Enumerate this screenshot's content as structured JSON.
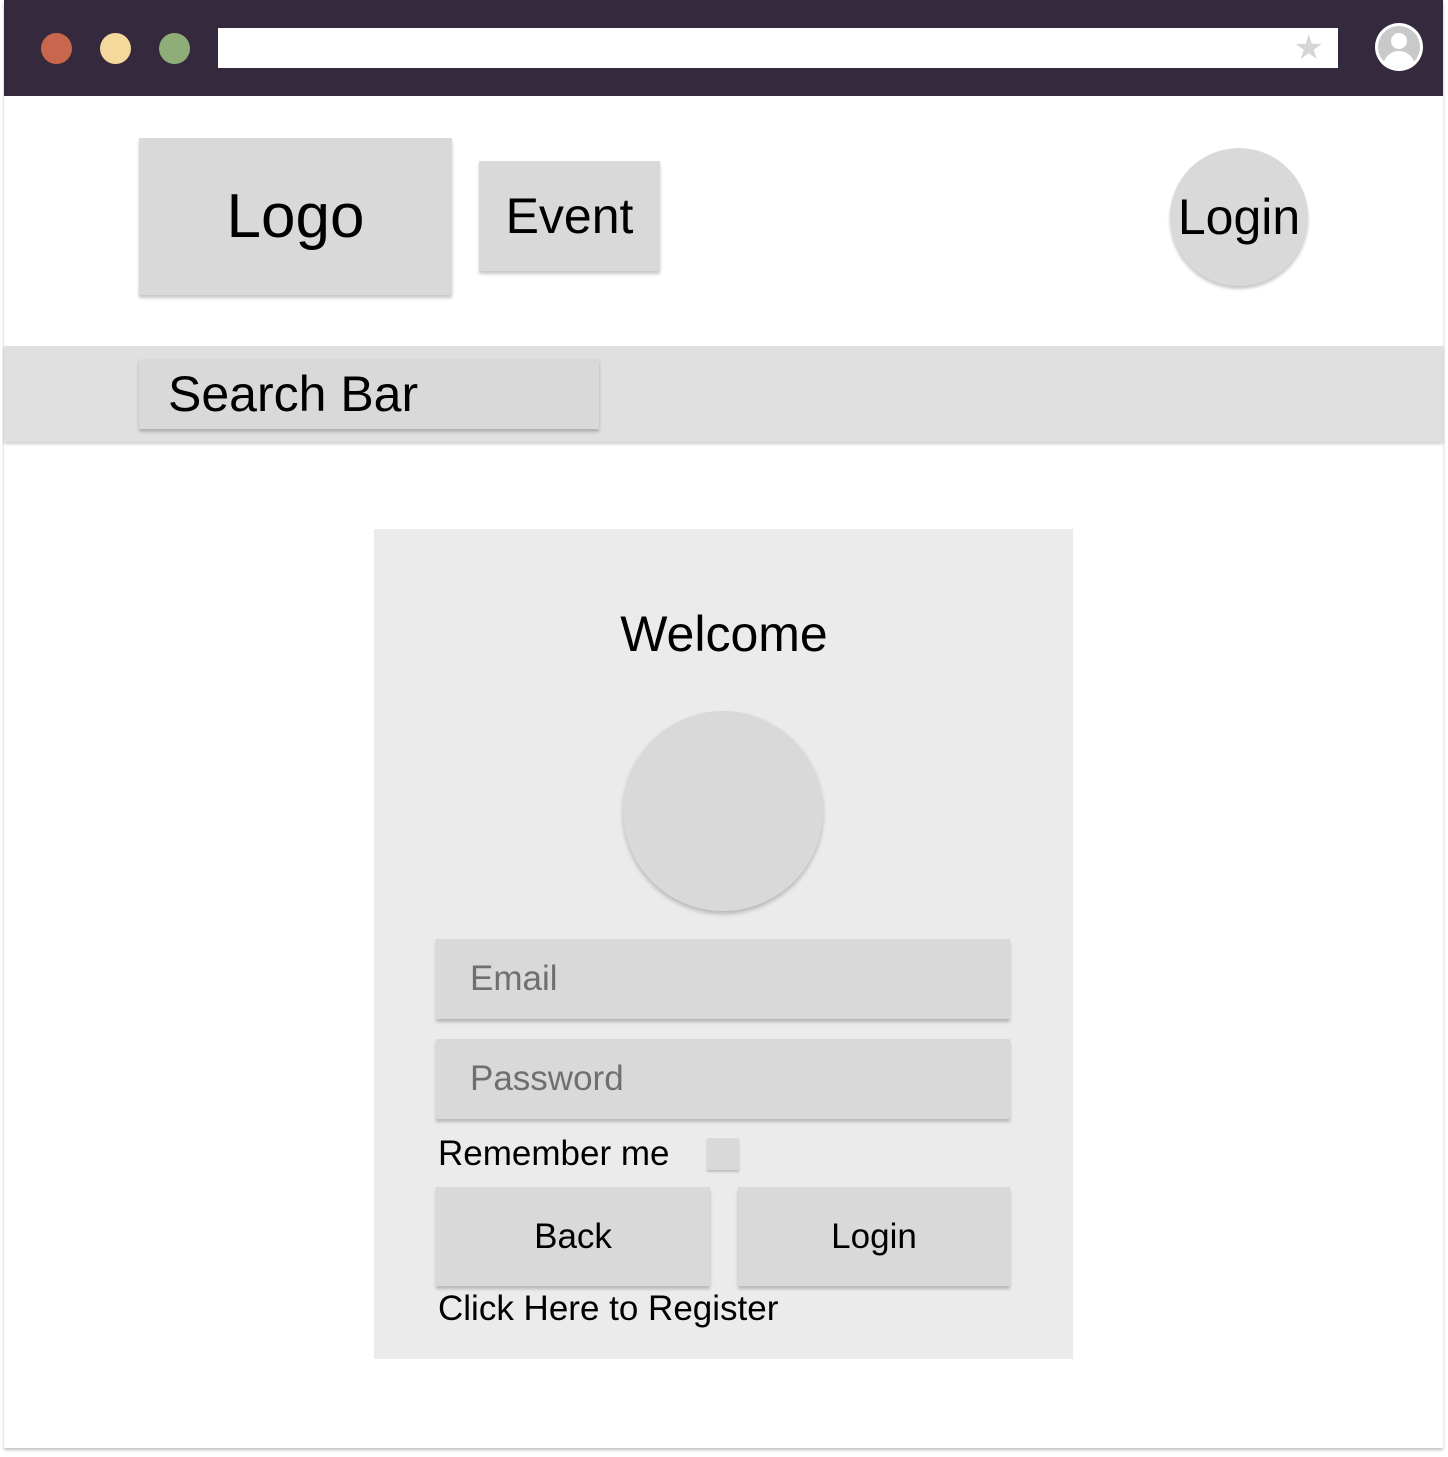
{
  "browser": {
    "colors": {
      "chrome": "#352a3d",
      "close": "#c8674e",
      "minimize": "#f5d89c",
      "maximize": "#8fad77",
      "star": "#d6d6d6"
    },
    "icons": {
      "bookmark": "star-icon",
      "profile": "user-profile-icon"
    }
  },
  "header": {
    "logo_label": "Logo",
    "event_label": "Event",
    "login_label": "Login"
  },
  "search": {
    "label": "Search Bar"
  },
  "login_form": {
    "title": "Welcome",
    "email_placeholder": "Email",
    "password_placeholder": "Password",
    "remember_label": "Remember me",
    "back_label": "Back",
    "login_label": "Login",
    "register_link": "Click Here to Register"
  }
}
